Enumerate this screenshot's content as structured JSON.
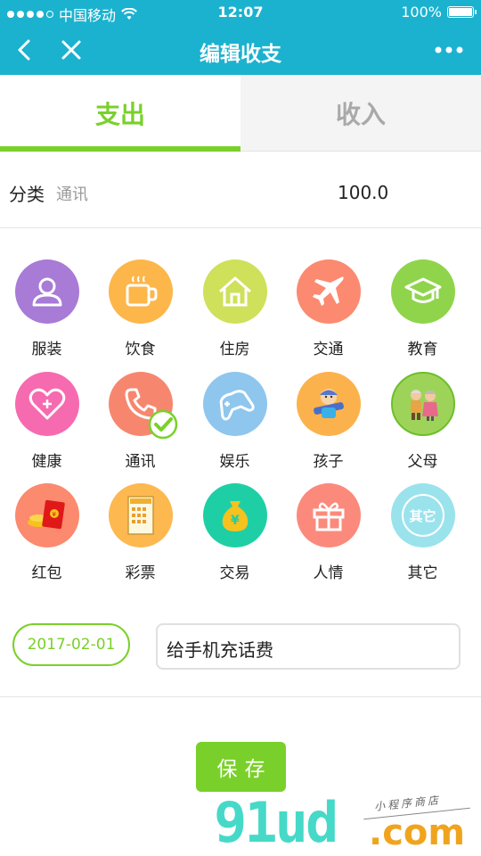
{
  "status_bar": {
    "carrier": "中国移动",
    "time": "12:07",
    "battery_text": "100%",
    "battery_level": 1.0
  },
  "nav": {
    "title": "编辑收支"
  },
  "tabs": [
    {
      "label": "支出",
      "active": true
    },
    {
      "label": "收入",
      "active": false
    }
  ],
  "category": {
    "label": "分类",
    "value": "通讯",
    "amount": "100.0"
  },
  "categories": [
    {
      "label": "服装",
      "icon": "person-icon",
      "color": "#a87bd6"
    },
    {
      "label": "饮食",
      "icon": "cup-icon",
      "color": "#fdb64a"
    },
    {
      "label": "住房",
      "icon": "house-icon",
      "color": "#cfe05a"
    },
    {
      "label": "交通",
      "icon": "airplane-icon",
      "color": "#fb8a70"
    },
    {
      "label": "教育",
      "icon": "graduation-cap-icon",
      "color": "#8fd44a"
    },
    {
      "label": "健康",
      "icon": "heart-icon",
      "color": "#f66ab0"
    },
    {
      "label": "通讯",
      "icon": "phone-icon",
      "color": "#f6876e",
      "selected": true
    },
    {
      "label": "娱乐",
      "icon": "gamepad-icon",
      "color": "#8ec6ee"
    },
    {
      "label": "孩子",
      "icon": "child-icon",
      "color": "#fcb24c"
    },
    {
      "label": "父母",
      "icon": "parents-icon",
      "color": "#9ed35a"
    },
    {
      "label": "红包",
      "icon": "red-envelope-icon",
      "color": "#fb8a6e"
    },
    {
      "label": "彩票",
      "icon": "lottery-icon",
      "color": "#fdb84f"
    },
    {
      "label": "交易",
      "icon": "money-bag-icon",
      "color": "#1ecfa6"
    },
    {
      "label": "人情",
      "icon": "gift-icon",
      "color": "#fb8a7c"
    },
    {
      "label": "其它",
      "icon": "other-icon",
      "color": "#9ae3ec",
      "icon_text": "其它"
    }
  ],
  "date": "2017-02-01",
  "remark": "给手机充话费",
  "save_label": "保存",
  "watermark": {
    "main": "91ud",
    "suffix": ".com",
    "sub": "小程序商店"
  },
  "colors": {
    "header": "#1bb2cf",
    "accent": "#7ad02a"
  }
}
